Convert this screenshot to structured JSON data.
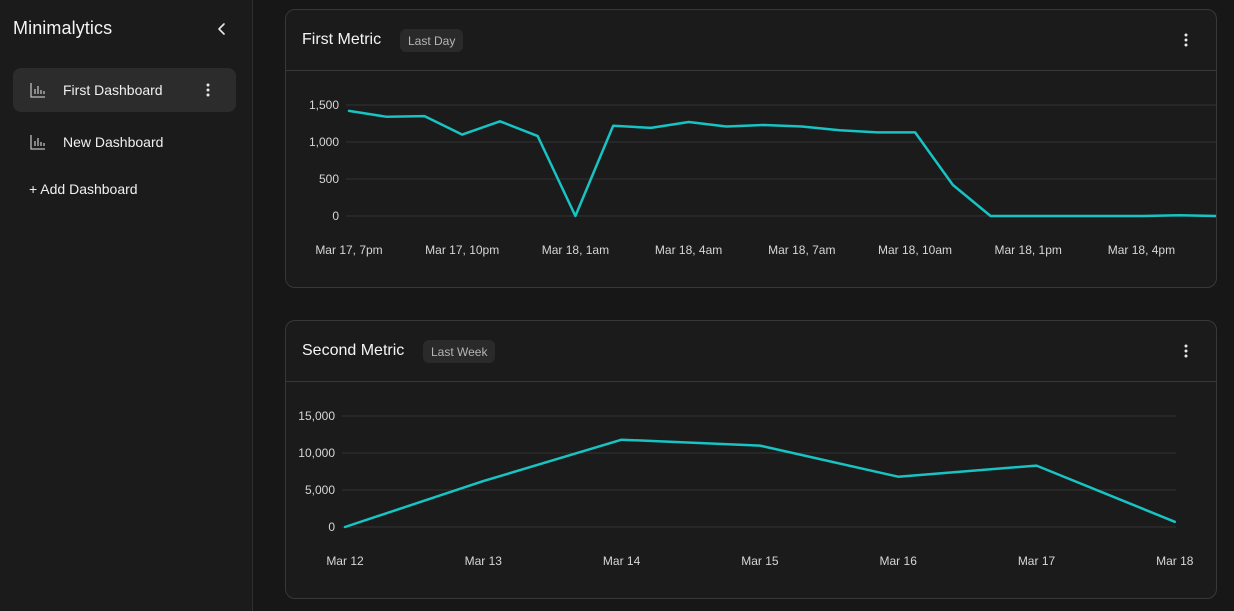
{
  "sidebar": {
    "brand": "Minimalytics",
    "items": [
      {
        "label": "First Dashboard",
        "active": true
      },
      {
        "label": "New Dashboard",
        "active": false
      }
    ],
    "add_label": "+ Add Dashboard"
  },
  "cards": [
    {
      "title": "First Metric",
      "range_badge": "Last Day",
      "chart_data": {
        "type": "line",
        "color": "#17c3c3",
        "y_ticks": [
          "1,500",
          "1,000",
          "500",
          "0"
        ],
        "x_ticks": [
          "Mar 17, 7pm",
          "Mar 17, 10pm",
          "Mar 18, 1am",
          "Mar 18, 4am",
          "Mar 18, 7am",
          "Mar 18, 10am",
          "Mar 18, 1pm",
          "Mar 18, 4pm"
        ],
        "ylim": [
          0,
          1500
        ],
        "x_hours": [
          0,
          1,
          2,
          3,
          4,
          5,
          6,
          7,
          8,
          9,
          10,
          11,
          12,
          13,
          14,
          15,
          16,
          17,
          18,
          19,
          20,
          21,
          22,
          23
        ],
        "values": [
          1420,
          1340,
          1350,
          1100,
          1280,
          1080,
          0,
          1220,
          1190,
          1270,
          1210,
          1230,
          1210,
          1160,
          1130,
          1130,
          420,
          0,
          0,
          0,
          0,
          0,
          10,
          0
        ]
      }
    },
    {
      "title": "Second Metric",
      "range_badge": "Last Week",
      "chart_data": {
        "type": "line",
        "color": "#17c3c3",
        "y_ticks": [
          "15,000",
          "10,000",
          "5,000",
          "0"
        ],
        "x_ticks": [
          "Mar 12",
          "Mar 13",
          "Mar 14",
          "Mar 15",
          "Mar 16",
          "Mar 17",
          "Mar 18"
        ],
        "ylim": [
          0,
          15000
        ],
        "values": [
          0,
          6200,
          11800,
          11000,
          6800,
          8300,
          700
        ]
      }
    }
  ],
  "icons": {
    "collapse": "chevron-left-icon",
    "dashboard": "bar-chart-icon",
    "more": "more-vertical-icon"
  }
}
